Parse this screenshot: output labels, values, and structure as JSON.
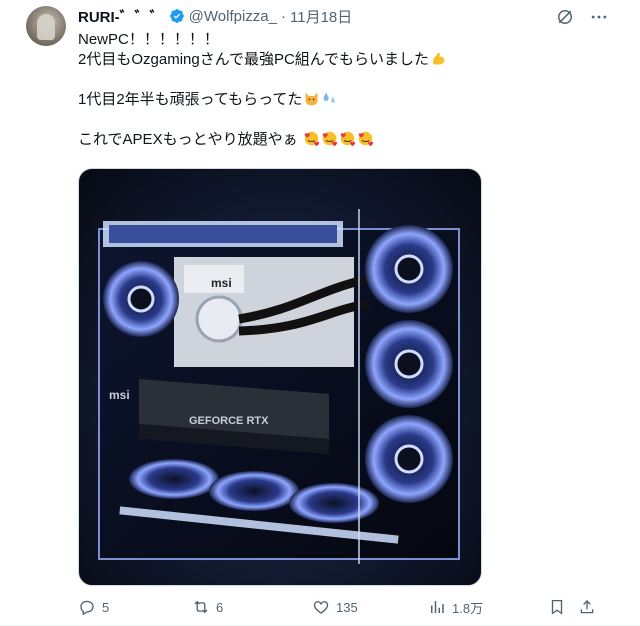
{
  "author": {
    "name": "RURI-゛゛゛",
    "handle": "@Wolfpizza_",
    "separator": "·",
    "date": "11月18日"
  },
  "tweet": {
    "line1": "NewPC！！！！！！",
    "line2": "2代目もOzgamingさんで最強PC組んでもらいました",
    "line3": "",
    "line4": "1代目2年半も頑張ってもらってた",
    "line5": "",
    "line6": "これでAPEXもっとやり放題やぁ"
  },
  "media": {
    "brand_top": "msi",
    "brand_gpu": "msi",
    "gpu_label": "GEFORCE RTX"
  },
  "metrics": {
    "replies": "5",
    "retweets": "6",
    "likes": "135",
    "views": "1.8万"
  },
  "icons": {
    "verified": "verified-badge-icon",
    "grok": "grok-icon",
    "more": "more-icon",
    "reply": "reply-icon",
    "retweet": "retweet-icon",
    "like": "heart-icon",
    "views": "views-icon",
    "bookmark": "bookmark-icon",
    "share": "share-icon"
  },
  "colors": {
    "accent": "#1d9bf0",
    "secondary_text": "#536471",
    "primary_text": "#0f1419"
  }
}
